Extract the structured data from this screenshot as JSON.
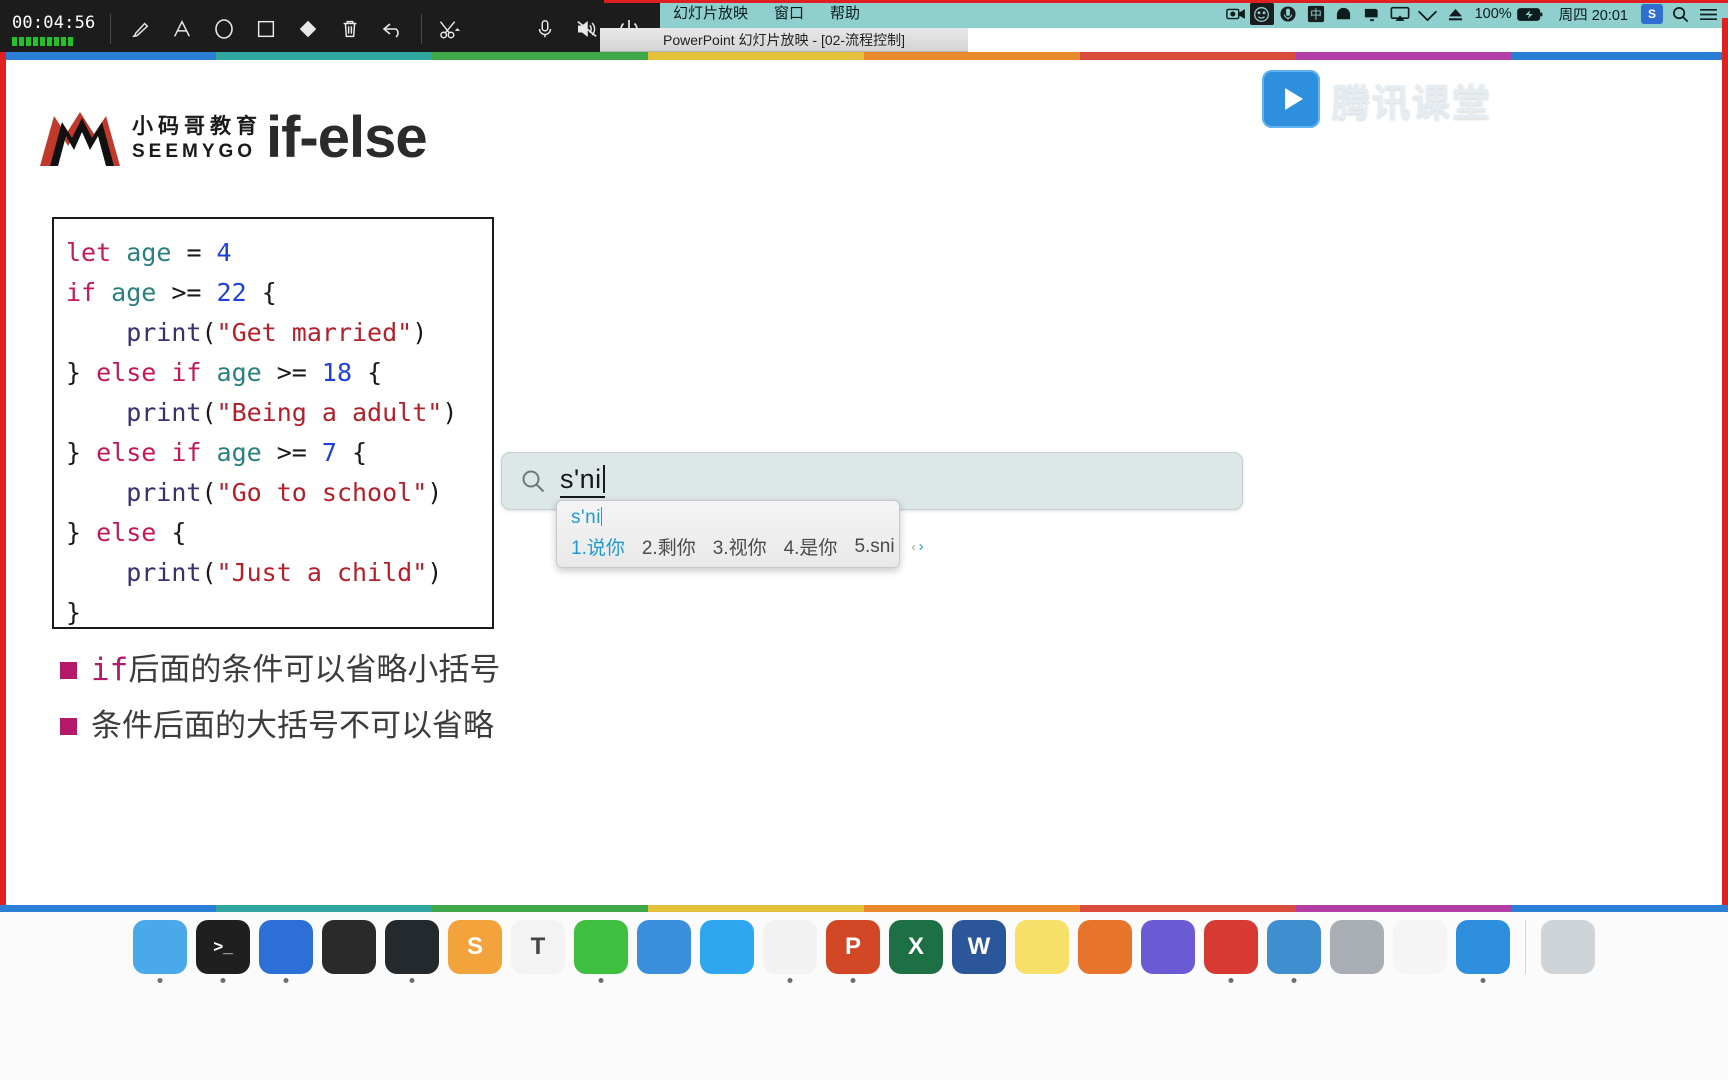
{
  "recorder": {
    "timer": "00:04:56",
    "level_bars": 9,
    "tools": [
      {
        "name": "brush-tool",
        "label": "Brush"
      },
      {
        "name": "text-tool",
        "label": "Text"
      },
      {
        "name": "ellipse-tool",
        "label": "Ellipse"
      },
      {
        "name": "rectangle-tool",
        "label": "Rectangle"
      },
      {
        "name": "eraser-tool",
        "label": "Eraser"
      },
      {
        "name": "trash-tool",
        "label": "Clear"
      },
      {
        "name": "undo-tool",
        "label": "Undo"
      },
      {
        "name": "scissors-tool",
        "label": "Cut"
      },
      {
        "name": "microphone-tool",
        "label": "Microphone"
      },
      {
        "name": "speaker-mute-tool",
        "label": "Mute"
      },
      {
        "name": "power-tool",
        "label": "Stop"
      }
    ]
  },
  "menubar": {
    "menus": [
      "幻灯片放映",
      "窗口",
      "帮助"
    ],
    "status_items": [
      {
        "name": "screen-record-icon",
        "glyph": "▣"
      },
      {
        "name": "emoji-icon",
        "glyph": "☺"
      },
      {
        "name": "microphone-icon",
        "glyph": "🎙"
      },
      {
        "name": "input-source-icon",
        "glyph": "中"
      },
      {
        "name": "dropbox-icon",
        "glyph": "◖"
      },
      {
        "name": "notification-icon",
        "glyph": "◣"
      },
      {
        "name": "airplay-icon",
        "glyph": "▭"
      },
      {
        "name": "wifi-icon",
        "glyph": "◺"
      },
      {
        "name": "eject-icon",
        "glyph": "⏏"
      }
    ],
    "battery_percent": "100%",
    "battery_state": "charging",
    "clock": "周四 20:01",
    "screenshot_badge": "S",
    "list_icon": "☰",
    "search_icon": "🔍"
  },
  "window": {
    "title": "PowerPoint 幻灯片放映 - [02-流程控制]"
  },
  "branding": {
    "watermark_text": "腾讯课堂"
  },
  "slide": {
    "logo": {
      "cn": "小码哥教育",
      "en": "SEEMYGO"
    },
    "title": "if-else",
    "code_lines": [
      [
        {
          "t": "let ",
          "c": "kw"
        },
        {
          "t": "age ",
          "c": "var"
        },
        {
          "t": "= ",
          "c": "pun"
        },
        {
          "t": "4",
          "c": "num"
        }
      ],
      [
        {
          "t": "if ",
          "c": "kw"
        },
        {
          "t": "age ",
          "c": "var"
        },
        {
          "t": ">= ",
          "c": "pun"
        },
        {
          "t": "22",
          "c": "num"
        },
        {
          "t": " {",
          "c": "pun"
        }
      ],
      [
        {
          "t": "    print",
          "c": "fn"
        },
        {
          "t": "(",
          "c": "pun"
        },
        {
          "t": "\"Get married\"",
          "c": "str"
        },
        {
          "t": ")",
          "c": "pun"
        }
      ],
      [
        {
          "t": "} ",
          "c": "pun"
        },
        {
          "t": "else if ",
          "c": "kw"
        },
        {
          "t": "age ",
          "c": "var"
        },
        {
          "t": ">= ",
          "c": "pun"
        },
        {
          "t": "18",
          "c": "num"
        },
        {
          "t": " {",
          "c": "pun"
        }
      ],
      [
        {
          "t": "    print",
          "c": "fn"
        },
        {
          "t": "(",
          "c": "pun"
        },
        {
          "t": "\"Being a adult\"",
          "c": "str"
        },
        {
          "t": ")",
          "c": "pun"
        }
      ],
      [
        {
          "t": "} ",
          "c": "pun"
        },
        {
          "t": "else if ",
          "c": "kw"
        },
        {
          "t": "age ",
          "c": "var"
        },
        {
          "t": ">= ",
          "c": "pun"
        },
        {
          "t": "7",
          "c": "num"
        },
        {
          "t": " {",
          "c": "pun"
        }
      ],
      [
        {
          "t": "    print",
          "c": "fn"
        },
        {
          "t": "(",
          "c": "pun"
        },
        {
          "t": "\"Go to school\"",
          "c": "str"
        },
        {
          "t": ")",
          "c": "pun"
        }
      ],
      [
        {
          "t": "} ",
          "c": "pun"
        },
        {
          "t": "else ",
          "c": "kw"
        },
        {
          "t": "{",
          "c": "pun"
        }
      ],
      [
        {
          "t": "    print",
          "c": "fn"
        },
        {
          "t": "(",
          "c": "pun"
        },
        {
          "t": "\"Just a child\"",
          "c": "str"
        },
        {
          "t": ")",
          "c": "pun"
        }
      ],
      [
        {
          "t": "}",
          "c": "pun"
        }
      ]
    ],
    "bullets": [
      {
        "code": "if",
        "text": "后面的条件可以省略小括号"
      },
      {
        "code": "",
        "text": "条件后面的大括号不可以省略"
      }
    ]
  },
  "search": {
    "value": "s'ni",
    "icon": "search-icon"
  },
  "ime": {
    "composing": "s'ni",
    "candidates": [
      {
        "index": "1.",
        "text": "说你",
        "selected": true
      },
      {
        "index": "2.",
        "text": "剩你",
        "selected": false
      },
      {
        "index": "3.",
        "text": "视你",
        "selected": false
      },
      {
        "index": "4.",
        "text": "是你",
        "selected": false
      },
      {
        "index": "5.",
        "text": "sni",
        "selected": false
      }
    ],
    "prev_arrow": "‹",
    "next_arrow": "›"
  },
  "dock": {
    "apps": [
      {
        "name": "finder",
        "label": "",
        "color": "#4aa9ea",
        "running": true
      },
      {
        "name": "terminal",
        "label": ">_",
        "color": "#1f1f1f",
        "running": true
      },
      {
        "name": "xcode",
        "label": "",
        "color": "#2c6fd6",
        "running": true
      },
      {
        "name": "keka",
        "label": "",
        "color": "#2a2a2a",
        "running": false
      },
      {
        "name": "github-desktop",
        "label": "",
        "color": "#24292e",
        "running": true
      },
      {
        "name": "sublime-text",
        "label": "S",
        "color": "#f2a33c",
        "running": false
      },
      {
        "name": "typora",
        "label": "T",
        "color": "#f3f3f3",
        "running": false
      },
      {
        "name": "wechat",
        "label": "",
        "color": "#3fbf3f",
        "running": true
      },
      {
        "name": "charles",
        "label": "",
        "color": "#3a8fdc",
        "running": false
      },
      {
        "name": "safari",
        "label": "",
        "color": "#2ea7f0",
        "running": false
      },
      {
        "name": "chrome",
        "label": "",
        "color": "#f2f2f2",
        "running": true
      },
      {
        "name": "powerpoint",
        "label": "P",
        "color": "#d24726",
        "running": true
      },
      {
        "name": "excel",
        "label": "X",
        "color": "#1d7044",
        "running": false
      },
      {
        "name": "word",
        "label": "W",
        "color": "#2b579a",
        "running": false
      },
      {
        "name": "notes",
        "label": "",
        "color": "#f7e06a",
        "running": false
      },
      {
        "name": "vlc",
        "label": "",
        "color": "#e8732a",
        "running": false
      },
      {
        "name": "iina",
        "label": "",
        "color": "#6a5bd4",
        "running": false
      },
      {
        "name": "netease-music",
        "label": "",
        "color": "#d63a32",
        "running": true
      },
      {
        "name": "screenflow",
        "label": "",
        "color": "#3f8fd0",
        "running": true
      },
      {
        "name": "system-preferences",
        "label": "",
        "color": "#a9aeb4",
        "running": false
      },
      {
        "name": "photos",
        "label": "",
        "color": "#f5f5f5",
        "running": false
      },
      {
        "name": "tencent-classroom",
        "label": "",
        "color": "#2e8fdf",
        "running": true
      },
      {
        "name": "trash",
        "label": "",
        "color": "#cfd4d8",
        "running": false
      }
    ]
  },
  "stripe_colors": [
    "#2b7ed6",
    "#2fa6a0",
    "#3fa84a",
    "#e3c13a",
    "#e8892e",
    "#d94b3a",
    "#b33fa6",
    "#2b7ed6"
  ]
}
